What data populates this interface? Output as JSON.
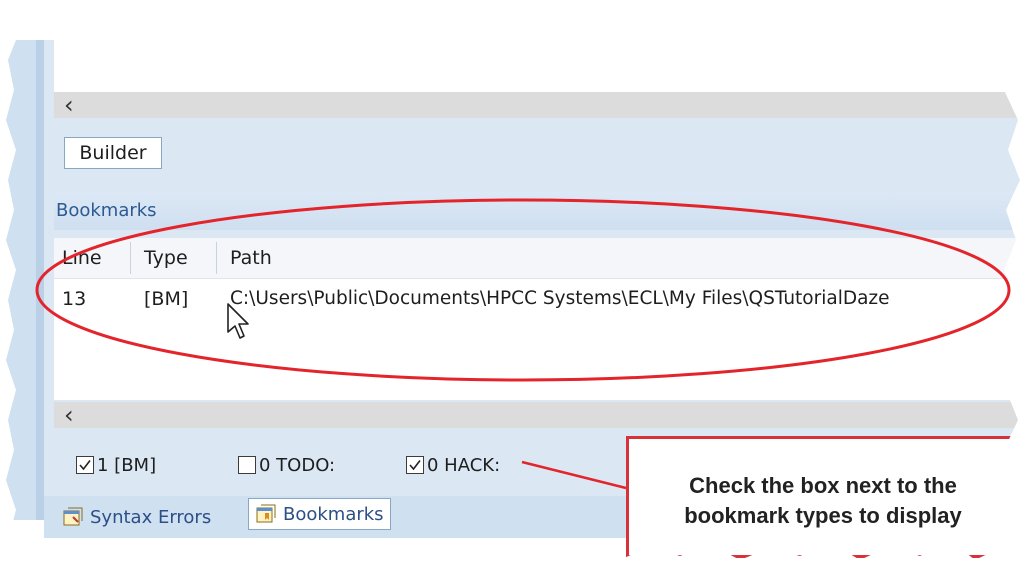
{
  "top_scroll": {
    "left_arrow": "‹"
  },
  "builder_tab": {
    "label": "Builder"
  },
  "bookmarks_panel": {
    "title": "Bookmarks",
    "columns": [
      "Line",
      "Type",
      "Path"
    ],
    "rows": [
      {
        "line": "13",
        "type": "[BM]",
        "path": "C:\\Users\\Public\\Documents\\HPCC Systems\\ECL\\My Files\\QSTutorialDaze"
      }
    ],
    "h_scroll_left_arrow": "‹"
  },
  "filters": [
    {
      "label": "1 [BM]",
      "checked": true
    },
    {
      "label": "0 TODO:",
      "checked": false
    },
    {
      "label": "0 HACK:",
      "checked": true
    }
  ],
  "bottom_tabs": [
    {
      "label": "Syntax Errors",
      "icon": "syntax-errors-icon",
      "active": false
    },
    {
      "label": "Bookmarks",
      "icon": "bookmarks-icon",
      "active": true
    }
  ],
  "callout": {
    "text_line1": "Check the box next to the",
    "text_line2": "bookmark types to display"
  },
  "colors": {
    "panel_bg": "#dbe8f4",
    "ellipse": "#e3242b",
    "callout_border": "#d9313a"
  }
}
